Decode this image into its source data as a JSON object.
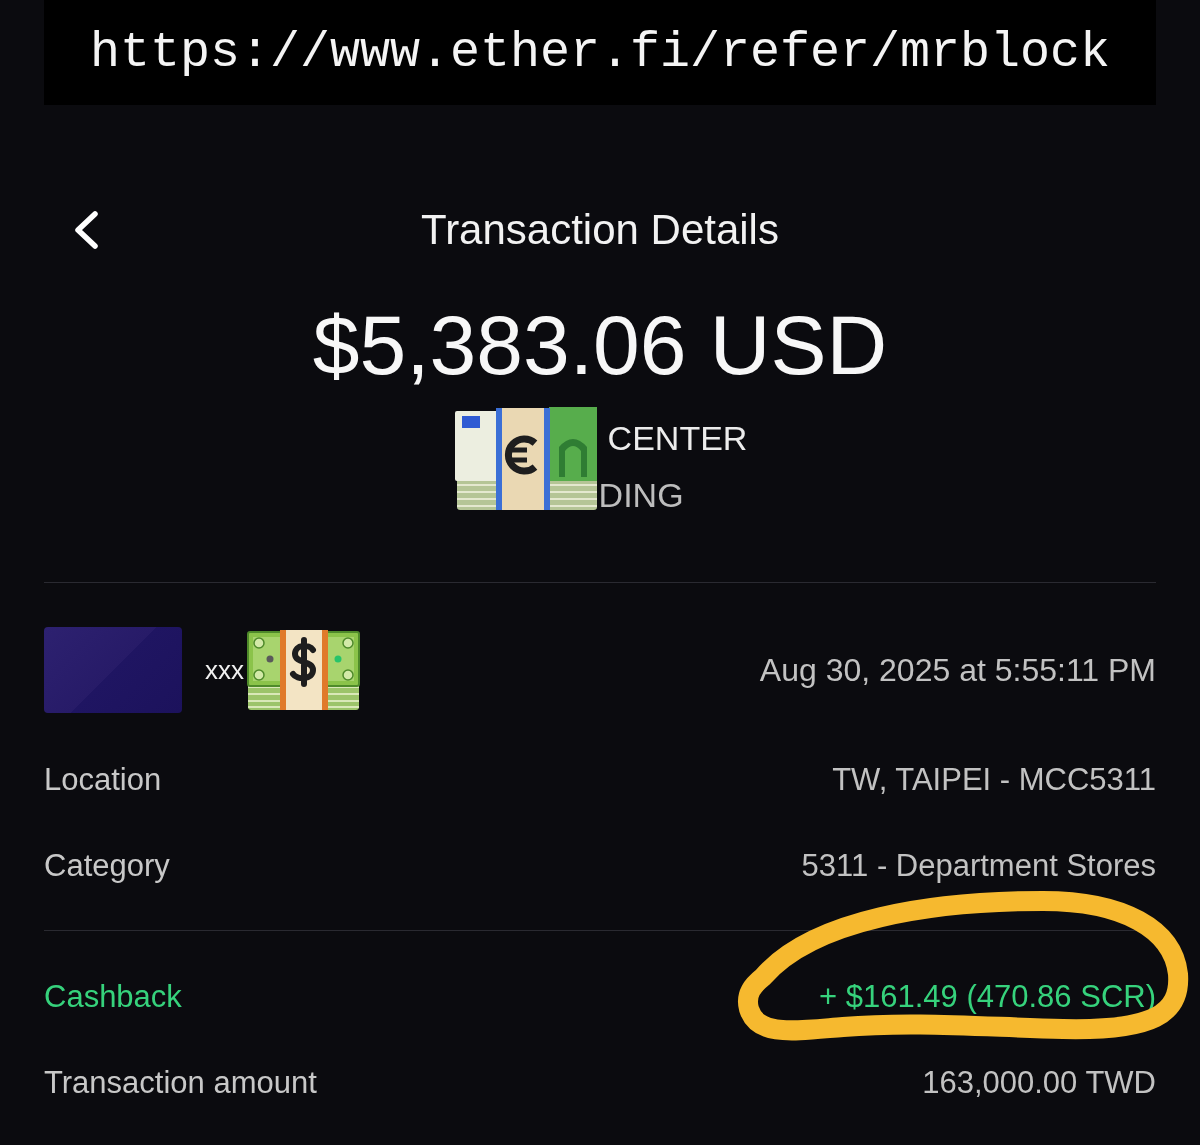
{
  "banner": {
    "text": "https://www.ether.fi/refer/mrblock"
  },
  "header": {
    "title": "Transaction Details"
  },
  "amount": "$5,383.06 USD",
  "merchant": {
    "name": "CENTER",
    "subtitle": "DING"
  },
  "card": {
    "number": "xxx",
    "date": "Aug 30, 2025 at 5:55:11 PM"
  },
  "sections": [
    {
      "rows": [
        {
          "kind": "plain",
          "label": "Location",
          "value": "TW, TAIPEI - MCC5311",
          "circled": false
        },
        {
          "kind": "plain",
          "label": "Category",
          "value": "5311 - Department Stores",
          "circled": false
        }
      ]
    },
    {
      "rows": [
        {
          "kind": "reward",
          "label": "Cashback",
          "value": "+ $161.49 (470.86 SCR)",
          "circled": true
        },
        {
          "kind": "plain",
          "label": "Transaction amount",
          "value": "163,000.00 TWD",
          "circled": false
        }
      ]
    }
  ]
}
